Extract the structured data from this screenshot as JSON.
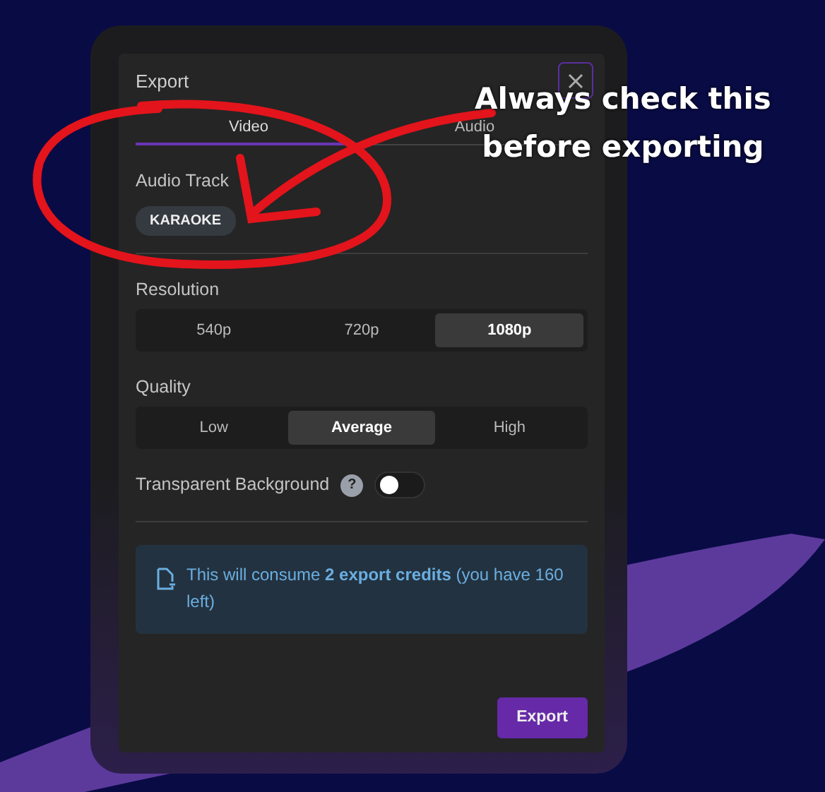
{
  "dialog": {
    "title": "Export",
    "tabs": [
      {
        "label": "Video",
        "selected": true
      },
      {
        "label": "Audio",
        "selected": false
      }
    ],
    "audio_track": {
      "label": "Audio Track",
      "chip": "KARAOKE"
    },
    "resolution": {
      "label": "Resolution",
      "options": [
        {
          "label": "540p",
          "selected": false
        },
        {
          "label": "720p",
          "selected": false
        },
        {
          "label": "1080p",
          "selected": true
        }
      ]
    },
    "quality": {
      "label": "Quality",
      "options": [
        {
          "label": "Low",
          "selected": false
        },
        {
          "label": "Average",
          "selected": true
        },
        {
          "label": "High",
          "selected": false
        }
      ]
    },
    "transparent_background": {
      "label": "Transparent Background",
      "help": "?",
      "on": false
    },
    "notice": "This will consume **2 export credits** (you have 160 left)",
    "export_button": "Export"
  },
  "annotation": {
    "lines": [
      "Always check this",
      "before exporting"
    ]
  }
}
